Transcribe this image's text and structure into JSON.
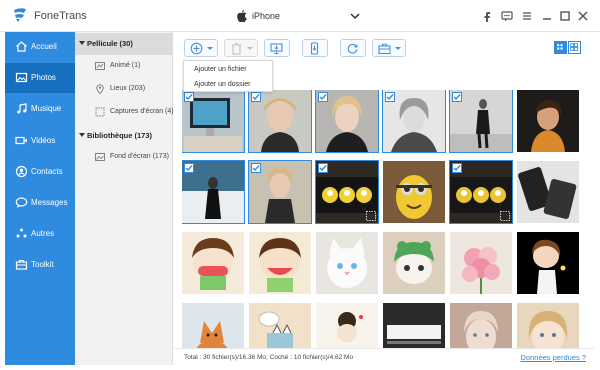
{
  "app": {
    "name": "FoneTrans",
    "device": "iPhone"
  },
  "window_controls": [
    "facebook-icon",
    "feedback-icon",
    "menu-icon",
    "minimize-icon",
    "maximize-icon",
    "close-icon"
  ],
  "sidebar": {
    "items": [
      {
        "label": "Accueil",
        "icon": "home-icon",
        "active": false
      },
      {
        "label": "Photos",
        "icon": "photos-icon",
        "active": true
      },
      {
        "label": "Musique",
        "icon": "music-icon",
        "active": false
      },
      {
        "label": "Vidéos",
        "icon": "video-icon",
        "active": false
      },
      {
        "label": "Contacts",
        "icon": "contacts-icon",
        "active": false
      },
      {
        "label": "Messages",
        "icon": "messages-icon",
        "active": false
      },
      {
        "label": "Autres",
        "icon": "others-icon",
        "active": false
      },
      {
        "label": "Toolkit",
        "icon": "toolkit-icon",
        "active": false
      }
    ]
  },
  "tree": {
    "pellicule": {
      "label": "Pellicule (30)"
    },
    "pellicule_items": [
      {
        "label": "Animé (1)",
        "icon": "animated-icon"
      },
      {
        "label": "Lieux (203)",
        "icon": "location-icon"
      },
      {
        "label": "Captures d'écran (4)",
        "icon": "screenshot-icon"
      }
    ],
    "bibliotheque": {
      "label": "Bibliothèque (173)"
    },
    "bibliotheque_items": [
      {
        "label": "Fond d'écran (173)",
        "icon": "wallpaper-icon"
      }
    ]
  },
  "toolbar": {
    "buttons": [
      "add-icon",
      "delete-icon",
      "export-to-pc-icon",
      "export-to-device-icon",
      "refresh-icon",
      "toolbox-icon"
    ],
    "add_menu": [
      "Ajouter un fichier",
      "Ajouter un dossier"
    ]
  },
  "photos": [
    {
      "checked": true
    },
    {
      "checked": true
    },
    {
      "checked": true
    },
    {
      "checked": true
    },
    {
      "checked": true
    },
    {
      "checked": false
    },
    {
      "checked": true
    },
    {
      "checked": true
    },
    {
      "checked": true
    },
    {
      "checked": false
    },
    {
      "checked": true
    },
    {
      "checked": false
    },
    {
      "checked": false
    },
    {
      "checked": false
    },
    {
      "checked": false
    },
    {
      "checked": false
    },
    {
      "checked": false
    },
    {
      "checked": false
    },
    {
      "checked": false
    },
    {
      "checked": false
    },
    {
      "checked": false
    },
    {
      "checked": false
    },
    {
      "checked": false
    },
    {
      "checked": false
    }
  ],
  "status": {
    "summary": "Total : 30 fichier(s)/16.36 Mo; Coché : 10 fichier(s)/4.62 Mo",
    "lost_data_link": "Données perdues ?"
  },
  "colors": {
    "accent": "#2e8be0",
    "sidebar_active": "#176fc0",
    "tree_bg": "#f2f2f2"
  }
}
